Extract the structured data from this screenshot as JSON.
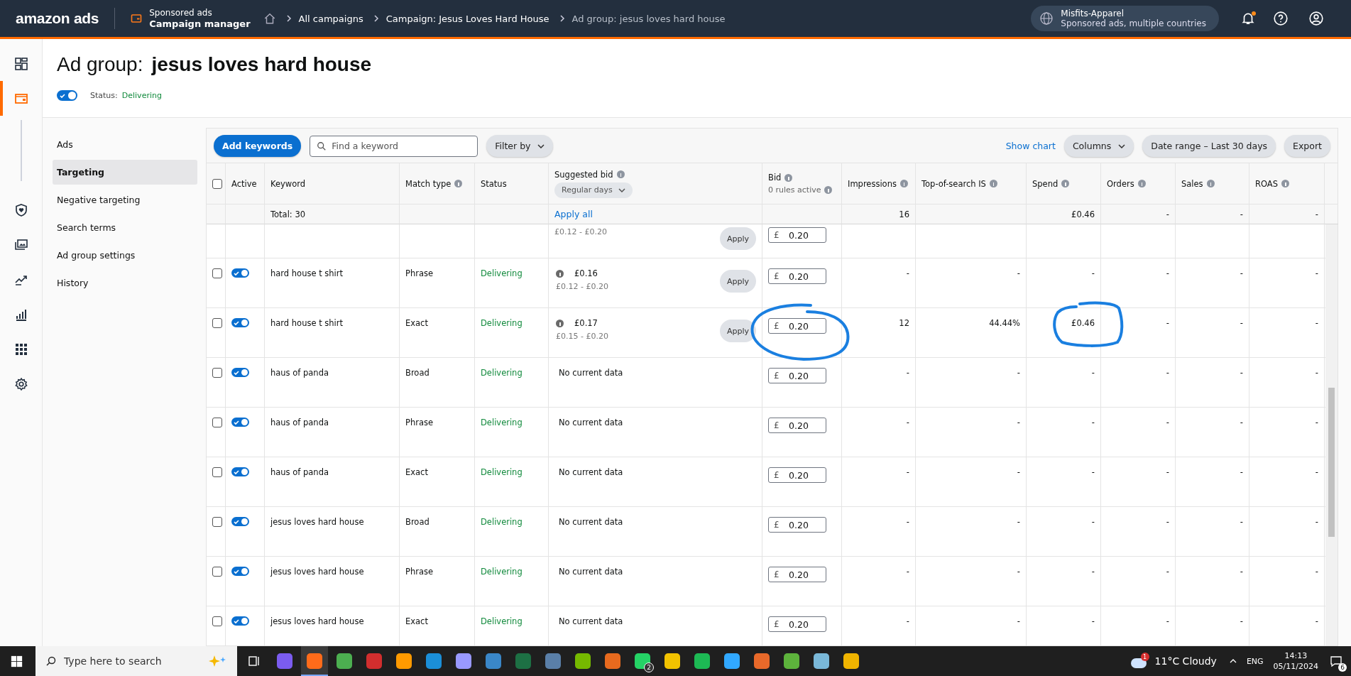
{
  "topbar": {
    "logo": "amazon ads",
    "product": {
      "line1": "Sponsored ads",
      "line2": "Campaign manager"
    },
    "breadcrumbs": [
      {
        "label": "All campaigns",
        "current": false
      },
      {
        "label": "Campaign: Jesus Loves Hard House",
        "current": false
      },
      {
        "label": "Ad group: jesus loves hard house",
        "current": true
      }
    ],
    "account": {
      "name": "Misfits-Apparel",
      "detail": "Sponsored ads, multiple countries"
    },
    "notification_dot": true
  },
  "rail": [
    {
      "kind": "dashboard",
      "selected": false
    },
    {
      "kind": "campaigns",
      "selected": true
    },
    {
      "kind": "shield",
      "selected": false
    },
    {
      "kind": "media",
      "selected": false
    },
    {
      "kind": "trend",
      "selected": false
    },
    {
      "kind": "bars",
      "selected": false
    },
    {
      "kind": "apps",
      "selected": false
    },
    {
      "kind": "settings",
      "selected": false
    }
  ],
  "header": {
    "prefix": "Ad group:",
    "name": "jesus loves hard house",
    "status_on": true,
    "status_label": "Status:",
    "status_value": "Delivering"
  },
  "subnav": [
    {
      "label": "Ads",
      "selected": false
    },
    {
      "label": "Targeting",
      "selected": true
    },
    {
      "label": "Negative targeting",
      "selected": false
    },
    {
      "label": "Search terms",
      "selected": false
    },
    {
      "label": "Ad group settings",
      "selected": false
    },
    {
      "label": "History",
      "selected": false
    }
  ],
  "toolbar": {
    "add": "Add keywords",
    "search_placeholder": "Find a keyword",
    "filter": "Filter by",
    "show_chart": "Show chart",
    "columns": "Columns",
    "date_range": "Date range – Last 30 days",
    "export": "Export"
  },
  "table": {
    "select_all_checked": false,
    "columns": {
      "active": "Active",
      "keyword": "Keyword",
      "match": "Match type",
      "status": "Status",
      "suggested": "Suggested bid",
      "suggested_menu": "Regular days",
      "bid": "Bid",
      "bid_sub": "0 rules active",
      "impressions": "Impressions",
      "tos": "Top-of-search IS",
      "spend": "Spend",
      "orders": "Orders",
      "sales": "Sales",
      "roas": "ROAS"
    },
    "totals": {
      "label": "Total: 30",
      "apply_all": "Apply all",
      "impressions": "16",
      "spend": "£0.46",
      "orders": "-",
      "sales": "-",
      "roas": "-"
    },
    "rows": [
      {
        "kind": "cut",
        "range": "£0.12 - £0.20",
        "apply": "Apply",
        "currency": "£",
        "bid": "0.20"
      },
      {
        "kind": "full",
        "checked": false,
        "active": true,
        "keyword": "hard house t shirt",
        "match": "Phrase",
        "status": "Delivering",
        "suggested": "£0.16",
        "range": "£0.12 - £0.20",
        "apply": "Apply",
        "currency": "£",
        "bid": "0.20",
        "impressions": "-",
        "tos": "-",
        "spend": "-",
        "orders": "-",
        "sales": "-",
        "roas": "-"
      },
      {
        "kind": "full",
        "checked": false,
        "active": true,
        "keyword": "hard house t shirt",
        "match": "Exact",
        "status": "Delivering",
        "suggested": "£0.17",
        "range": "£0.15 - £0.20",
        "apply": "Apply",
        "currency": "£",
        "bid": "0.20",
        "impressions": "12",
        "tos": "44.44%",
        "spend": "£0.46",
        "orders": "-",
        "sales": "-",
        "roas": "-",
        "bid_circled": true,
        "spend_circled": true
      },
      {
        "kind": "full",
        "checked": false,
        "active": true,
        "keyword": "haus of panda",
        "match": "Broad",
        "status": "Delivering",
        "no_data": "No current data",
        "currency": "£",
        "bid": "0.20",
        "impressions": "-",
        "tos": "-",
        "spend": "-",
        "orders": "-",
        "sales": "-",
        "roas": "-"
      },
      {
        "kind": "full",
        "checked": false,
        "active": true,
        "keyword": "haus of panda",
        "match": "Phrase",
        "status": "Delivering",
        "no_data": "No current data",
        "currency": "£",
        "bid": "0.20",
        "impressions": "-",
        "tos": "-",
        "spend": "-",
        "orders": "-",
        "sales": "-",
        "roas": "-"
      },
      {
        "kind": "full",
        "checked": false,
        "active": true,
        "keyword": "haus of panda",
        "match": "Exact",
        "status": "Delivering",
        "no_data": "No current data",
        "currency": "£",
        "bid": "0.20",
        "impressions": "-",
        "tos": "-",
        "spend": "-",
        "orders": "-",
        "sales": "-",
        "roas": "-"
      },
      {
        "kind": "full",
        "checked": false,
        "active": true,
        "keyword": "jesus loves hard house",
        "match": "Broad",
        "status": "Delivering",
        "no_data": "No current data",
        "currency": "£",
        "bid": "0.20",
        "impressions": "-",
        "tos": "-",
        "spend": "-",
        "orders": "-",
        "sales": "-",
        "roas": "-"
      },
      {
        "kind": "full",
        "checked": false,
        "active": true,
        "keyword": "jesus loves hard house",
        "match": "Phrase",
        "status": "Delivering",
        "no_data": "No current data",
        "currency": "£",
        "bid": "0.20",
        "impressions": "-",
        "tos": "-",
        "spend": "-",
        "orders": "-",
        "sales": "-",
        "roas": "-"
      },
      {
        "kind": "full",
        "checked": false,
        "active": true,
        "keyword": "jesus loves hard house",
        "match": "Exact",
        "status": "Delivering",
        "no_data": "No current data",
        "currency": "£",
        "bid": "0.20",
        "impressions": "-",
        "tos": "-",
        "spend": "-",
        "orders": "-",
        "sales": "-",
        "roas": "-"
      }
    ]
  },
  "taskbar": {
    "search_placeholder": "Type here to search",
    "apps": [
      {
        "color": "#7b5cf0",
        "selected": false
      },
      {
        "color": "#ff6b1a",
        "selected": true
      },
      {
        "color": "#4caf50",
        "selected": false
      },
      {
        "color": "#d22e2e",
        "selected": false
      },
      {
        "color": "#ff9a00",
        "selected": false
      },
      {
        "color": "#1b8fd8",
        "selected": false
      },
      {
        "color": "#9999ff",
        "selected": false
      },
      {
        "color": "#3a87c8",
        "selected": false
      },
      {
        "color": "#1d7044",
        "selected": false
      },
      {
        "color": "#5a7fa8",
        "selected": false
      },
      {
        "color": "#76b900",
        "selected": false
      },
      {
        "color": "#e86a1e",
        "selected": false
      },
      {
        "color": "#25d366",
        "badge": "2",
        "selected": false
      },
      {
        "color": "#f2c200",
        "selected": false
      },
      {
        "color": "#1db954",
        "selected": false
      },
      {
        "color": "#31a8ff",
        "selected": false
      },
      {
        "color": "#e8692a",
        "selected": false
      },
      {
        "color": "#5db33c",
        "selected": false
      },
      {
        "color": "#7ab8d8",
        "selected": false
      },
      {
        "color": "#f0b400",
        "selected": false
      }
    ],
    "weather": "11°C  Cloudy",
    "weather_badge": "1",
    "language": "ENG",
    "time": "14:13",
    "date": "05/11/2024",
    "notifications": "6"
  }
}
